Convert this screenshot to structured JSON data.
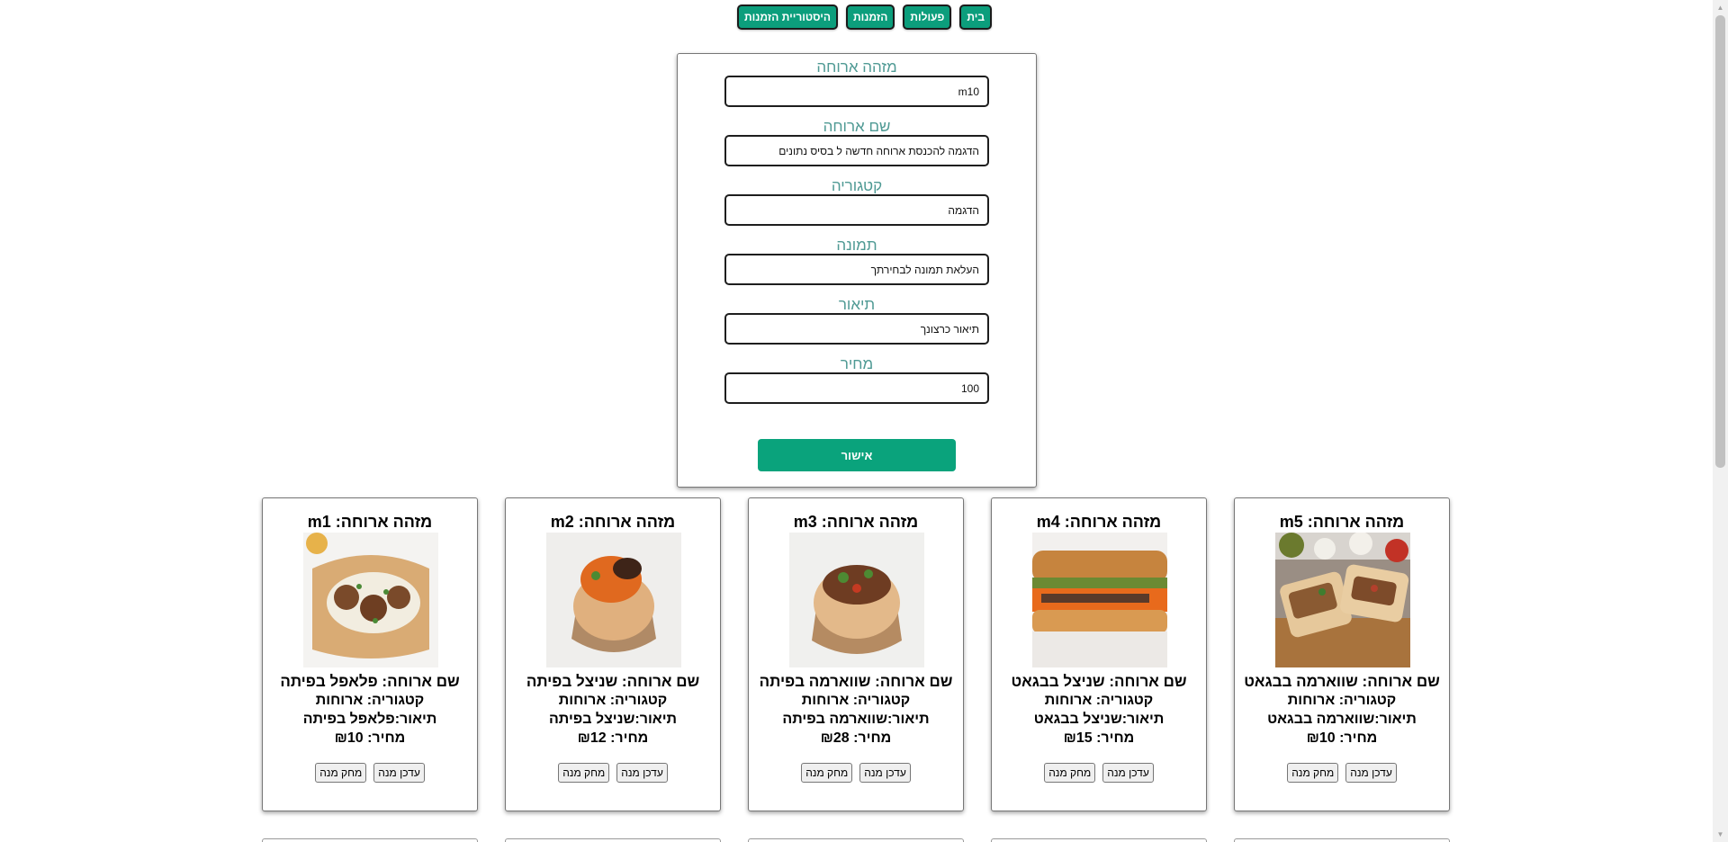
{
  "nav": {
    "home": "בית",
    "actions": "פעולות",
    "orders": "הזמנות",
    "order_history": "היסטוריית הזמנות"
  },
  "form": {
    "meal_id": {
      "label": "מזהה ארוחה",
      "value": "m10"
    },
    "meal_name": {
      "label": "שם ארוחה",
      "value": "הדגמה להכנסת ארוחה חדשה ל בסיס נתונים"
    },
    "category": {
      "label": "קטגוריה",
      "value": "הדגמה"
    },
    "image": {
      "label": "תמונה",
      "value": "העלאת תמונה לבחירתך"
    },
    "description": {
      "label": "תיאור",
      "value": "תיאור כרצונך"
    },
    "price": {
      "label": "מחיר",
      "value": "100"
    },
    "submit": "אישור"
  },
  "cards": [
    {
      "id_text": "מזהה ארוחה: m5",
      "name": "שם ארוחה: שווארמה בבגאט",
      "category": "קטגוריה: ארוחות",
      "description": "תיאור:שווארמה בבגאט",
      "price": "מחיר: ₪10",
      "update": "עדכן מנה",
      "delete": "מחק מנה"
    },
    {
      "id_text": "מזהה ארוחה: m4",
      "name": "שם ארוחה: שניצל בבגאט",
      "category": "קטגוריה: ארוחות",
      "description": "תיאור:שניצל בבגאט",
      "price": "מחיר: ₪15",
      "update": "עדכן מנה",
      "delete": "מחק מנה"
    },
    {
      "id_text": "מזהה ארוחה: m3",
      "name": "שם ארוחה: שווארמה בפיתה",
      "category": "קטגוריה: ארוחות",
      "description": "תיאור:שווארמה בפיתה",
      "price": "מחיר: ₪28",
      "update": "עדכן מנה",
      "delete": "מחק מנה"
    },
    {
      "id_text": "מזהה ארוחה: m2",
      "name": "שם ארוחה: שניצל בפיתה",
      "category": "קטגוריה: ארוחות",
      "description": "תיאור:שניצל בפיתה",
      "price": "מחיר: ₪12",
      "update": "עדכן מנה",
      "delete": "מחק מנה"
    },
    {
      "id_text": "מזהה ארוחה: m1",
      "name": "שם ארוחה: פלאפל בפיתה",
      "category": "קטגוריה: ארוחות",
      "description": "תיאור:פלאפל בפיתה",
      "price": "מחיר: ₪10",
      "update": "עדכן מנה",
      "delete": "מחק מנה"
    }
  ],
  "colors": {
    "nav_button": "#0c9e7c",
    "label_teal": "#4f9a94",
    "submit": "#0aa37c"
  }
}
